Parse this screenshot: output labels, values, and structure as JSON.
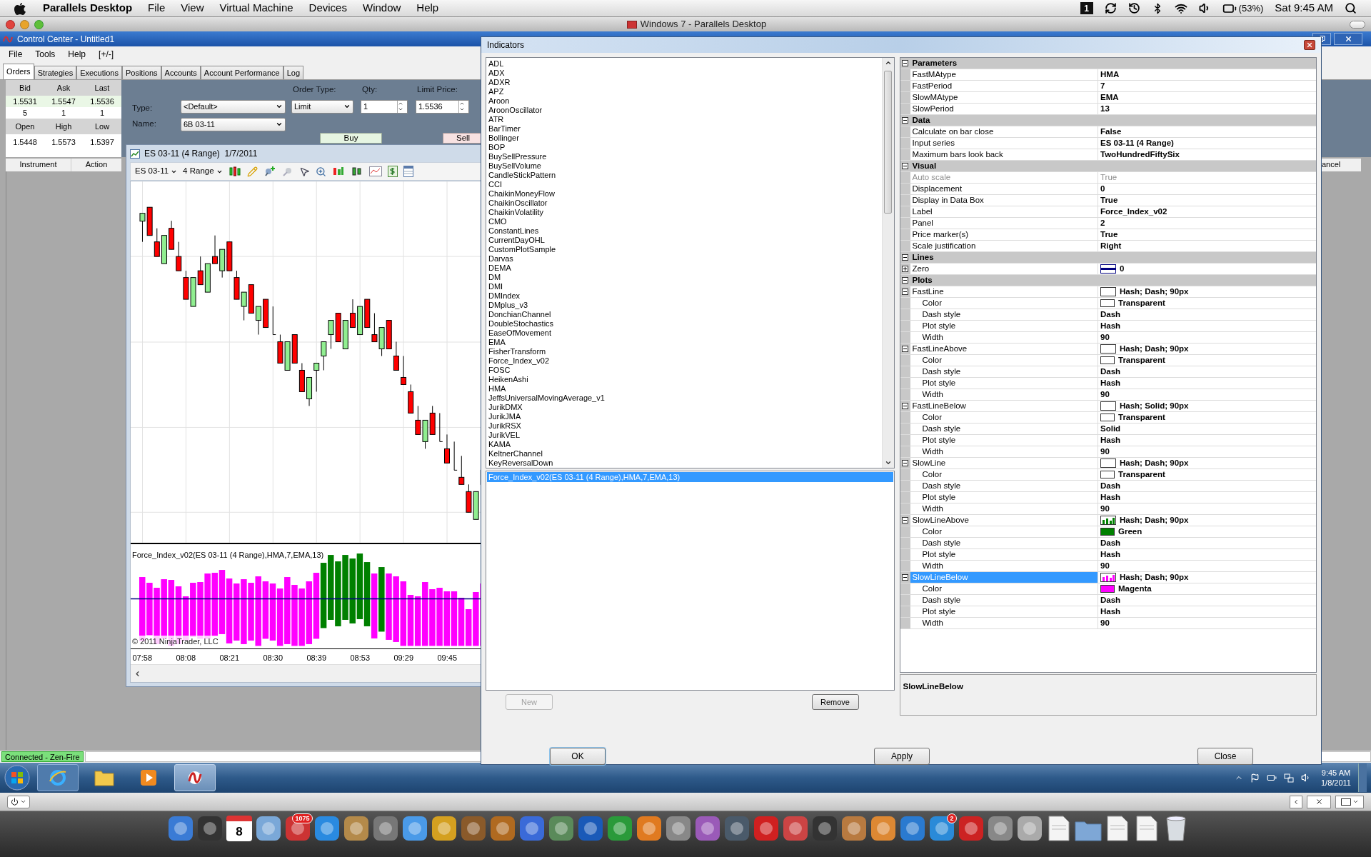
{
  "mac_menubar": {
    "app": "Parallels Desktop",
    "menus": [
      "File",
      "View",
      "Virtual Machine",
      "Devices",
      "Window",
      "Help"
    ],
    "spaces": "1",
    "battery": "(53%)",
    "clock": "Sat 9:45 AM"
  },
  "parallels_window": {
    "title": "Windows 7 - Parallels Desktop"
  },
  "control_center": {
    "title": "Control Center - Untitled1",
    "menus": [
      "File",
      "Tools",
      "Help",
      "[+/-]"
    ],
    "tabs": [
      {
        "label": "Orders",
        "selected": true
      },
      {
        "label": "Strategies",
        "selected": false
      },
      {
        "label": "Executions",
        "selected": false
      },
      {
        "label": "Positions",
        "selected": false
      },
      {
        "label": "Accounts",
        "selected": false
      },
      {
        "label": "Account Performance",
        "selected": false
      },
      {
        "label": "Log",
        "selected": false
      }
    ],
    "quote": {
      "headers": [
        "Bid",
        "Ask",
        "Last"
      ],
      "prices": [
        "1.5531",
        "1.5547",
        "1.5536"
      ],
      "sizes": [
        "5",
        "1",
        "1"
      ],
      "headers2": [
        "Open",
        "High",
        "Low"
      ],
      "prices2": [
        "1.5448",
        "1.5573",
        "1.5397"
      ]
    },
    "order": {
      "type_label": "Type:",
      "type_value": "<Default>",
      "name_label": "Name:",
      "name_value": "6B 03-11",
      "order_type_label": "Order Type:",
      "order_type_value": "Limit",
      "qty_label": "Qty:",
      "qty_value": "1",
      "limit_label": "Limit Price:",
      "limit_value": "1.5536",
      "buy": "Buy",
      "sell": "Sell"
    },
    "columns": [
      "Instrument",
      "Action"
    ],
    "right_column": "ancel",
    "status": "Connected - Zen-Fire"
  },
  "chart_window": {
    "title": "ES 03-11 (4 Range)  1/7/2011",
    "instrument": "ES 03-11",
    "period": "4 Range",
    "indicator_label": "Force_Index_v02(ES 03-11 (4 Range),HMA,7,EMA,13)",
    "copyright": "© 2011 NinjaTrader, LLC",
    "x_labels": [
      "07:58",
      "08:08",
      "08:21",
      "08:30",
      "08:39",
      "08:53",
      "09:29",
      "09:45"
    ]
  },
  "dialog": {
    "title": "Indicators",
    "indicators": [
      "ADL",
      "ADX",
      "ADXR",
      "APZ",
      "Aroon",
      "AroonOscillator",
      "ATR",
      "BarTimer",
      "Bollinger",
      "BOP",
      "BuySellPressure",
      "BuySellVolume",
      "CandleStickPattern",
      "CCI",
      "ChaikinMoneyFlow",
      "ChaikinOscillator",
      "ChaikinVolatility",
      "CMO",
      "ConstantLines",
      "CurrentDayOHL",
      "CustomPlotSample",
      "Darvas",
      "DEMA",
      "DM",
      "DMI",
      "DMIndex",
      "DMplus_v3",
      "DonchianChannel",
      "DoubleStochastics",
      "EaseOfMovement",
      "EMA",
      "FisherTransform",
      "Force_Index_v02",
      "FOSC",
      "HeikenAshi",
      "HMA",
      "JeffsUniversalMovingAverage_v1",
      "JurikDMX",
      "JurikJMA",
      "JurikRSX",
      "JurikVEL",
      "KAMA",
      "KeltnerChannel",
      "KeyReversalDown"
    ],
    "applied": [
      {
        "label": "Force_Index_v02(ES 03-11 (4 Range),HMA,7,EMA,13)",
        "selected": true
      }
    ],
    "new_button": {
      "label": "New",
      "disabled": true
    },
    "remove_button": "Remove",
    "properties": [
      {
        "name": "Parameters",
        "expanded": true,
        "rows": [
          {
            "name": "FastMAtype",
            "value": "HMA",
            "kind": "text",
            "selected": false,
            "disabled": false
          },
          {
            "name": "FastPeriod",
            "value": "7",
            "kind": "text",
            "selected": false,
            "disabled": false
          },
          {
            "name": "SlowMAtype",
            "value": "EMA",
            "kind": "text",
            "selected": false,
            "disabled": false
          },
          {
            "name": "SlowPeriod",
            "value": "13",
            "kind": "text",
            "selected": false,
            "disabled": false
          }
        ]
      },
      {
        "name": "Data",
        "expanded": true,
        "rows": [
          {
            "name": "Calculate on bar close",
            "value": "False",
            "kind": "text",
            "selected": false,
            "disabled": false
          },
          {
            "name": "Input series",
            "value": "ES 03-11 (4 Range)",
            "kind": "text",
            "selected": false,
            "disabled": false
          },
          {
            "name": "Maximum bars look back",
            "value": "TwoHundredFiftySix",
            "kind": "text",
            "selected": false,
            "disabled": false
          }
        ]
      },
      {
        "name": "Visual",
        "expanded": true,
        "rows": [
          {
            "name": "Auto scale",
            "value": "True",
            "kind": "text",
            "selected": false,
            "disabled": true
          },
          {
            "name": "Displacement",
            "value": "0",
            "kind": "text",
            "selected": false,
            "disabled": false
          },
          {
            "name": "Display in Data Box",
            "value": "True",
            "kind": "text",
            "selected": false,
            "disabled": false
          },
          {
            "name": "Label",
            "value": "Force_Index_v02",
            "kind": "text",
            "selected": false,
            "disabled": false
          },
          {
            "name": "Panel",
            "value": "2",
            "kind": "text",
            "selected": false,
            "disabled": false
          },
          {
            "name": "Price marker(s)",
            "value": "True",
            "kind": "text",
            "selected": false,
            "disabled": false
          },
          {
            "name": "Scale justification",
            "value": "Right",
            "kind": "text",
            "selected": false,
            "disabled": false
          }
        ]
      },
      {
        "name": "Lines",
        "expanded": true,
        "rows": [
          {
            "name": "Zero",
            "value": "0",
            "kind": "line",
            "color": "#000080",
            "selected": false,
            "disabled": false,
            "expanded": false
          }
        ]
      },
      {
        "name": "Plots",
        "expanded": true,
        "rows": [
          {
            "name": "FastLine",
            "value": "Hash; Dash; 90px",
            "kind": "plot",
            "selected": false,
            "disabled": false,
            "expanded": true,
            "children": [
              {
                "name": "Color",
                "value": "Transparent",
                "kind": "color",
                "selected": false,
                "disabled": false
              },
              {
                "name": "Dash style",
                "value": "Dash",
                "kind": "text",
                "selected": false,
                "disabled": false
              },
              {
                "name": "Plot style",
                "value": "Hash",
                "kind": "text",
                "selected": false,
                "disabled": false
              },
              {
                "name": "Width",
                "value": "90",
                "kind": "text",
                "selected": false,
                "disabled": false
              }
            ]
          },
          {
            "name": "FastLineAbove",
            "value": "Hash; Dash; 90px",
            "kind": "plot",
            "selected": false,
            "disabled": false,
            "expanded": true,
            "children": [
              {
                "name": "Color",
                "value": "Transparent",
                "kind": "color",
                "selected": false,
                "disabled": false
              },
              {
                "name": "Dash style",
                "value": "Dash",
                "kind": "text",
                "selected": false,
                "disabled": false
              },
              {
                "name": "Plot style",
                "value": "Hash",
                "kind": "text",
                "selected": false,
                "disabled": false
              },
              {
                "name": "Width",
                "value": "90",
                "kind": "text",
                "selected": false,
                "disabled": false
              }
            ]
          },
          {
            "name": "FastLineBelow",
            "value": "Hash; Solid; 90px",
            "kind": "plot",
            "selected": false,
            "disabled": false,
            "expanded": true,
            "children": [
              {
                "name": "Color",
                "value": "Transparent",
                "kind": "color",
                "selected": false,
                "disabled": false
              },
              {
                "name": "Dash style",
                "value": "Solid",
                "kind": "text",
                "selected": false,
                "disabled": false
              },
              {
                "name": "Plot style",
                "value": "Hash",
                "kind": "text",
                "selected": false,
                "disabled": false
              },
              {
                "name": "Width",
                "value": "90",
                "kind": "text",
                "selected": false,
                "disabled": false
              }
            ]
          },
          {
            "name": "SlowLine",
            "value": "Hash; Dash; 90px",
            "kind": "plot",
            "selected": false,
            "disabled": false,
            "expanded": true,
            "children": [
              {
                "name": "Color",
                "value": "Transparent",
                "kind": "color",
                "selected": false,
                "disabled": false
              },
              {
                "name": "Dash style",
                "value": "Dash",
                "kind": "text",
                "selected": false,
                "disabled": false
              },
              {
                "name": "Plot style",
                "value": "Hash",
                "kind": "text",
                "selected": false,
                "disabled": false
              },
              {
                "name": "Width",
                "value": "90",
                "kind": "text",
                "selected": false,
                "disabled": false
              }
            ]
          },
          {
            "name": "SlowLineAbove",
            "value": "Hash; Dash; 90px",
            "kind": "plot",
            "color": "#008000",
            "selected": false,
            "disabled": false,
            "expanded": true,
            "children": [
              {
                "name": "Color",
                "value": "Green",
                "kind": "color",
                "color": "#008000",
                "selected": false,
                "disabled": false
              },
              {
                "name": "Dash style",
                "value": "Dash",
                "kind": "text",
                "selected": false,
                "disabled": false
              },
              {
                "name": "Plot style",
                "value": "Hash",
                "kind": "text",
                "selected": false,
                "disabled": false
              },
              {
                "name": "Width",
                "value": "90",
                "kind": "text",
                "selected": false,
                "disabled": false
              }
            ]
          },
          {
            "name": "SlowLineBelow",
            "value": "Hash; Dash; 90px",
            "kind": "plot",
            "color": "#ff00ff",
            "selected": true,
            "disabled": false,
            "expanded": true,
            "children": [
              {
                "name": "Color",
                "value": "Magenta",
                "kind": "color",
                "color": "#ff00ff",
                "selected": false,
                "disabled": false
              },
              {
                "name": "Dash style",
                "value": "Dash",
                "kind": "text",
                "selected": false,
                "disabled": false
              },
              {
                "name": "Plot style",
                "value": "Hash",
                "kind": "text",
                "selected": false,
                "disabled": false
              },
              {
                "name": "Width",
                "value": "90",
                "kind": "text",
                "selected": false,
                "disabled": false
              }
            ]
          }
        ]
      }
    ],
    "description": "SlowLineBelow",
    "ok": "OK",
    "apply": "Apply",
    "close": "Close"
  },
  "taskbar": {
    "time": "9:45 AM",
    "date": "1/8/2011"
  },
  "dock": [
    {
      "kind": "app"
    },
    {
      "kind": "app"
    },
    {
      "kind": "calendar",
      "label": "8"
    },
    {
      "kind": "app"
    },
    {
      "kind": "app",
      "badge": "1075"
    },
    {
      "kind": "app"
    },
    {
      "kind": "app"
    },
    {
      "kind": "app"
    },
    {
      "kind": "app"
    },
    {
      "kind": "app"
    },
    {
      "kind": "app"
    },
    {
      "kind": "app"
    },
    {
      "kind": "app"
    },
    {
      "kind": "app"
    },
    {
      "kind": "app"
    },
    {
      "kind": "app"
    },
    {
      "kind": "app"
    },
    {
      "kind": "app"
    },
    {
      "kind": "app"
    },
    {
      "kind": "app"
    },
    {
      "kind": "app"
    },
    {
      "kind": "app"
    },
    {
      "kind": "app"
    },
    {
      "kind": "app"
    },
    {
      "kind": "app"
    },
    {
      "kind": "app"
    },
    {
      "kind": "app",
      "badge": "2"
    },
    {
      "kind": "app"
    },
    {
      "kind": "app"
    },
    {
      "kind": "app"
    },
    {
      "kind": "document"
    },
    {
      "kind": "folder"
    },
    {
      "kind": "document"
    },
    {
      "kind": "document"
    },
    {
      "kind": "trash"
    }
  ]
}
